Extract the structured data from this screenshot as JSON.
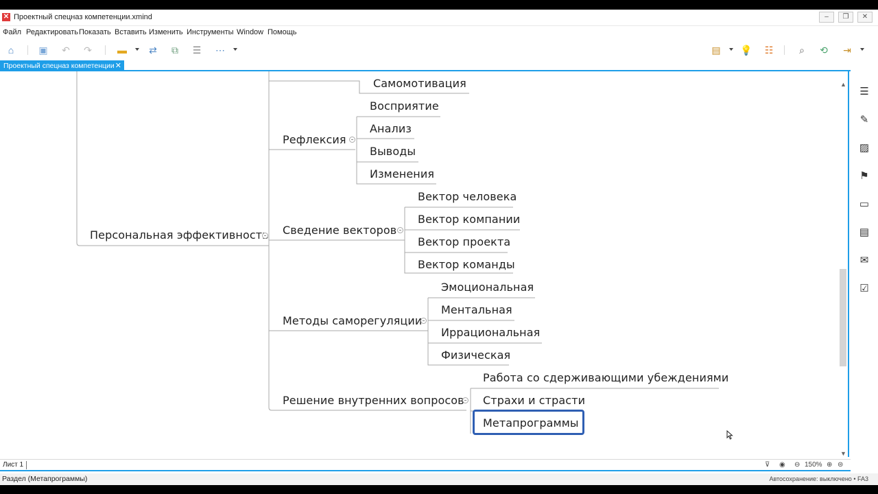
{
  "window": {
    "title": "Проектный спецназ компетенции.xmind",
    "minimize": "‒",
    "restore": "❐",
    "close": "✕"
  },
  "menu": [
    "Файл",
    "Редактировать",
    "Показать",
    "Вставить",
    "Изменить",
    "Инструменты",
    "Window",
    "Помощь"
  ],
  "tab": {
    "label": "Проектный спецназ компетенции",
    "close": "✕"
  },
  "mindmap": {
    "root": "Персональная эффективность",
    "partial_top": "Самомотивация",
    "branches": [
      {
        "label": "Рефлексия",
        "children": [
          "Восприятие",
          "Анализ",
          "Выводы",
          "Изменения"
        ]
      },
      {
        "label": "Сведение векторов",
        "children": [
          "Вектор человека",
          "Вектор компании",
          "Вектор проекта",
          "Вектор команды"
        ]
      },
      {
        "label": "Методы саморегуляции",
        "children": [
          "Эмоциональная",
          "Ментальная",
          "Иррациональная",
          "Физическая"
        ]
      },
      {
        "label": "Решение внутренних вопросов",
        "children": [
          "Работа со сдерживающими убеждениями",
          "Страхи и страсти",
          "Метапрограммы"
        ]
      }
    ],
    "selected": "Метапрограммы",
    "selection_color": "#2f5fb3",
    "line_color": "#a8a8a8"
  },
  "sheet": {
    "label": "Лист 1"
  },
  "zoom": {
    "level": "150%"
  },
  "status": {
    "left": "Раздел (Метапрограммы)",
    "autosave": "Автосохранение: выключено",
    "extra": "FA3"
  },
  "colors": {
    "accent": "#1e9ee8",
    "tab_text": "#ffffff"
  }
}
